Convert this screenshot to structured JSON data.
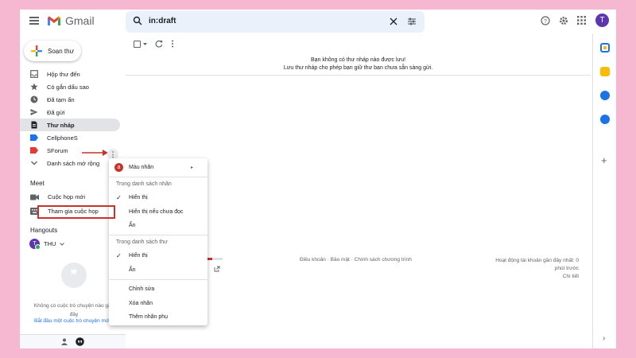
{
  "header": {
    "app_name": "Gmail",
    "search_value": "in:draft"
  },
  "sidebar": {
    "compose_label": "Soạn thư",
    "items": [
      {
        "label": "Hộp thư đến",
        "icon": "inbox-icon"
      },
      {
        "label": "Có gắn dấu sao",
        "icon": "star-icon"
      },
      {
        "label": "Đã tạm ẩn",
        "icon": "clock-icon"
      },
      {
        "label": "Đã gửi",
        "icon": "send-icon"
      },
      {
        "label": "Thư nháp",
        "icon": "draft-icon",
        "active": true
      },
      {
        "label": "CellphoneS",
        "icon": "label-icon",
        "color": "#1a73e8"
      },
      {
        "label": "SForum",
        "icon": "label-icon",
        "color": "#e53935"
      },
      {
        "label": "Danh sách mở rộng",
        "icon": "chevron-down-icon"
      }
    ],
    "meet": {
      "title": "Meet",
      "new_meeting": "Cuộc họp mới",
      "join_meeting": "Tham gia cuộc họp"
    },
    "hangouts": {
      "title": "Hangouts",
      "user": "THU",
      "user_initial": "T",
      "empty_text": "Không có cuộc trò chuyện nào gần đây",
      "start_link": "Bắt đầu một cuộc trò chuyện mới"
    }
  },
  "main": {
    "empty_line1": "Bạn không có thư nháp nào được lưu!",
    "empty_line2": "Lưu thư nháp cho phép bạn giữ thư bạn chưa sẵn sàng gửi.",
    "footer_links": "Điều khoản · Bảo mật · Chính sách chương trình",
    "last_activity": "Hoạt động tài khoản gần đây nhất: 0 phút trước",
    "details": "Chi tiết"
  },
  "context_menu": {
    "label_color": "Màu nhãn",
    "color_letter": "a",
    "in_label_list_header": "Trong danh sách nhãn",
    "show": "Hiển thị",
    "show_if_unread": "Hiển thị nếu chưa đọc",
    "hide": "Ẩn",
    "in_message_list_header": "Trong danh sách thư",
    "show2": "Hiển thị",
    "hide2": "Ẩn",
    "edit": "Chỉnh sửa",
    "remove_label": "Xóa nhãn",
    "add_sublabel": "Thêm nhãn phụ"
  },
  "user_initial": "T",
  "colors": {
    "background": "#f5b8d0",
    "accent_red": "#c5332b",
    "avatar": "#5e35b1"
  }
}
